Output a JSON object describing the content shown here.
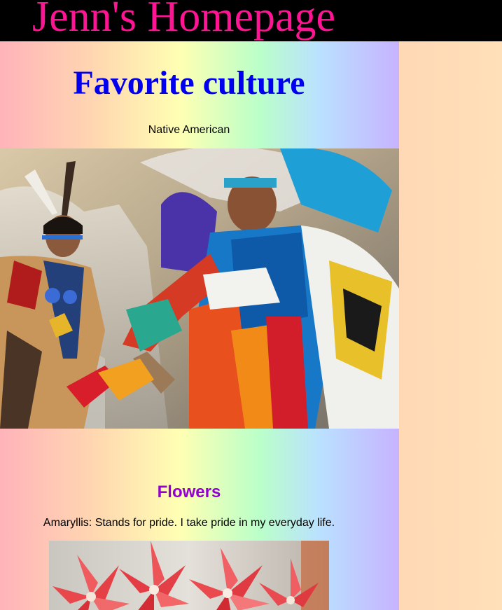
{
  "header": {
    "title": "Jenn's Homepage",
    "background": "#000000",
    "title_color": "#ff1493"
  },
  "culture": {
    "heading": "Favorite culture",
    "heading_color": "#0000ee",
    "subtext": "Native American",
    "image_icon": "powwow-dancers-photo"
  },
  "flowers": {
    "heading": "Flowers",
    "heading_color": "#9400d3",
    "text": "Amaryllis: Stands for pride. I take pride in my everyday life.",
    "image_icon": "amaryllis-flowers-photo"
  },
  "colors": {
    "rainbow": [
      "#ffb3ba",
      "#ffd9b0",
      "#ffffb3",
      "#baffc9",
      "#bae1ff",
      "#c7b3ff"
    ]
  }
}
